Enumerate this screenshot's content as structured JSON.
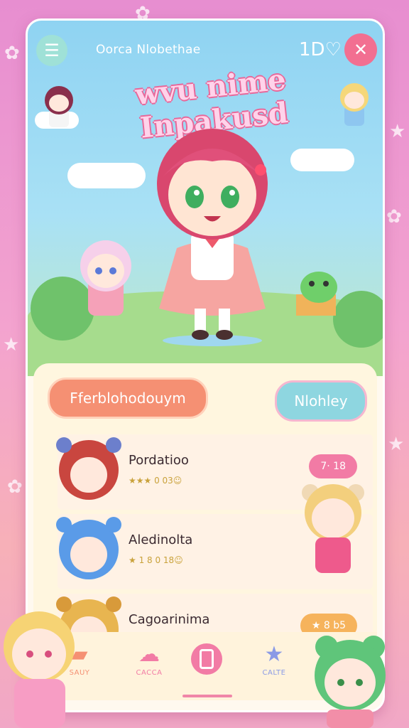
{
  "topbar": {
    "menu_icon": "☰",
    "title": "Oorca Nlobethae",
    "heart_label": "1D",
    "close_icon": "✕"
  },
  "hero": {
    "title": "wvu nime Inpakusd"
  },
  "actions": {
    "primary_label": "Fferblohodouym",
    "secondary_label": "Nlohley"
  },
  "list": [
    {
      "name": "Pordatioo",
      "meta": "★★★ 0 03☺",
      "badge": "7· 18",
      "badge_color": "#f27ba5"
    },
    {
      "name": "Aledinolta",
      "meta": "★ 1 8 0 18☺",
      "badge": "",
      "badge_color": ""
    },
    {
      "name": "Cagoarinima",
      "meta": "★ ·· ·",
      "badge": "★ 8 b5",
      "badge_color": "#f6b35c"
    }
  ],
  "nav": [
    {
      "label": "SAUY",
      "color": "#f59073"
    },
    {
      "label": "CACCA",
      "color": "#f27ba5"
    },
    {
      "label": "",
      "color": "#f27ba5"
    },
    {
      "label": "CALTE",
      "color": "#8a9ae6"
    }
  ],
  "colors": {
    "accent_pink": "#f27ba5",
    "accent_orange": "#f59073",
    "accent_teal": "#8ed6e0"
  }
}
